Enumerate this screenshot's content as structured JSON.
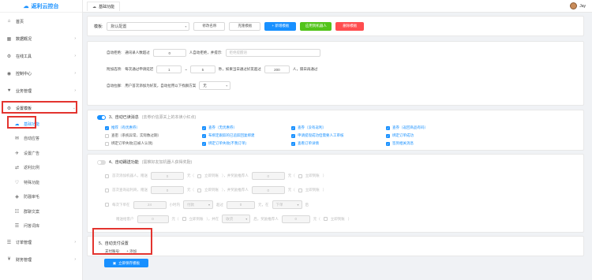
{
  "app": {
    "title": "返利云控台"
  },
  "sidebar": {
    "items": [
      {
        "label": "首页",
        "icon": "home-icon"
      },
      {
        "label": "数据概况",
        "icon": "chart-icon",
        "arrow": "›"
      },
      {
        "label": "在线工具",
        "icon": "tool-icon",
        "arrow": "›"
      },
      {
        "label": "控制中心",
        "icon": "control-icon",
        "arrow": "›"
      },
      {
        "label": "业务管理",
        "icon": "business-icon",
        "arrow": "›"
      },
      {
        "label": "设置模板",
        "icon": "settings-icon",
        "arrow": "⌄"
      }
    ],
    "subitems": [
      {
        "label": "基础功能",
        "icon": "cloud-icon"
      },
      {
        "label": "自动应答",
        "icon": "chat-icon"
      },
      {
        "label": "设置广告",
        "icon": "ad-icon"
      },
      {
        "label": "返利比例",
        "icon": "ratio-icon"
      },
      {
        "label": "特殊功能",
        "icon": "special-icon"
      },
      {
        "label": "防骚审毛",
        "icon": "shield-icon"
      },
      {
        "label": "群聊文案",
        "icon": "group-icon"
      },
      {
        "label": "问答词库",
        "icon": "qa-icon"
      }
    ],
    "bottom_items": [
      {
        "label": "订单管理",
        "icon": "order-icon",
        "arrow": "›"
      },
      {
        "label": "财务管理",
        "icon": "finance-icon",
        "arrow": "›"
      }
    ]
  },
  "topbar": {
    "tab_label": "基础功能",
    "user_name": "Jay"
  },
  "toolbar": {
    "template_label": "模板:",
    "template_value": "默认配置",
    "rename_label": "修改名称",
    "clone_label": "克隆模板",
    "add_label": "+ 新增模板",
    "apply_label": "应用到机器人",
    "delete_label": "删除模板",
    "colors": {
      "blue": "#1890ff",
      "green": "#52c41a",
      "red": "#ff4d4f"
    }
  },
  "section_top": {
    "auto_reject": {
      "prefix": "自动拒绝:",
      "text1": "通讯录人数超过",
      "value": "0",
      "text2": "人自动拒绝，并提示:",
      "placeholder": "拒绝提醒语"
    },
    "auto_pass": {
      "prefix": "附加选项:",
      "text1": "每次通过申请延迟",
      "v1": "1",
      "dash": "~",
      "v2": "5",
      "text2": "秒，如果当日通过好友超过",
      "v3": "200",
      "text3": "人，隔日再通过"
    },
    "auto_group": {
      "prefix": "自动拉群:",
      "text1": "用户首次添加为好友，自动拉用以下找群方案",
      "select": "无"
    }
  },
  "section3": {
    "title": "3、自动已读消息",
    "hint": "(去券价信源关上的本读小红点)",
    "checkboxes": [
      {
        "label": "推荐（有优惠券）",
        "checked": true,
        "hl": true
      },
      {
        "label": "查券（无优惠券）",
        "checked": true,
        "hl": true
      },
      {
        "label": "查券（没有返利）",
        "checked": true,
        "hl": true
      },
      {
        "label": "查券（返回商品有码）",
        "checked": true,
        "hl": true
      },
      {
        "label": "查密（系统异常，实际数过期）",
        "checked": false,
        "hl": false
      },
      {
        "label": "布绑定跟踪的已追踪回复绑建",
        "checked": true,
        "hl": true
      },
      {
        "label": "申请提现成功但需要人工审核",
        "checked": true,
        "hl": true
      },
      {
        "label": "绑定订单成功",
        "checked": true,
        "hl": true
      },
      {
        "label": "绑定订单失败(已被人认领)",
        "checked": false,
        "hl": false
      },
      {
        "label": "绑定订单失败(不我订单)",
        "checked": true,
        "hl": true
      },
      {
        "label": "查看订单详情",
        "checked": true,
        "hl": true
      },
      {
        "label": "签到相关消息",
        "checked": true,
        "hl": true
      }
    ]
  },
  "section4": {
    "title": "4、自动踢送功能",
    "hint": "(需推好友加机器人获得奖励)",
    "row1": {
      "a": "首次添加机器人，赠送",
      "v1": "0",
      "b": "元（",
      "c": "立即到账",
      "d": "），并奖励推荐人",
      "v2": "0",
      "e": "元（",
      "f": "立即到账",
      "g": "）"
    },
    "row2": {
      "a": "首次查询返利商，赠送",
      "v1": "0",
      "b": "元（",
      "c": "立即到账",
      "d": "），并奖励推荐人",
      "v2": "0",
      "e": "元（",
      "f": "立即到账",
      "g": "）"
    },
    "row3": {
      "a": "每次下单在",
      "v1": "24",
      "b": "小时内",
      "sel": "付款",
      "c": "超过",
      "v2": "0",
      "d": "元，在",
      "sel2": "下单",
      "e": "后"
    },
    "row4": {
      "a": "赠送给客户",
      "v1": "0",
      "b": "元（",
      "c": "立即到账",
      "d": "），并在",
      "sel": "收货",
      "e": "后，奖励推荐人",
      "v2": "0",
      "f": "元（",
      "g": "立即到账",
      "h": "）"
    }
  },
  "section5": {
    "title": "5、自动支付设置",
    "label": "支付账号:",
    "add": "+ 添加"
  },
  "save_label": "立即保存模板"
}
